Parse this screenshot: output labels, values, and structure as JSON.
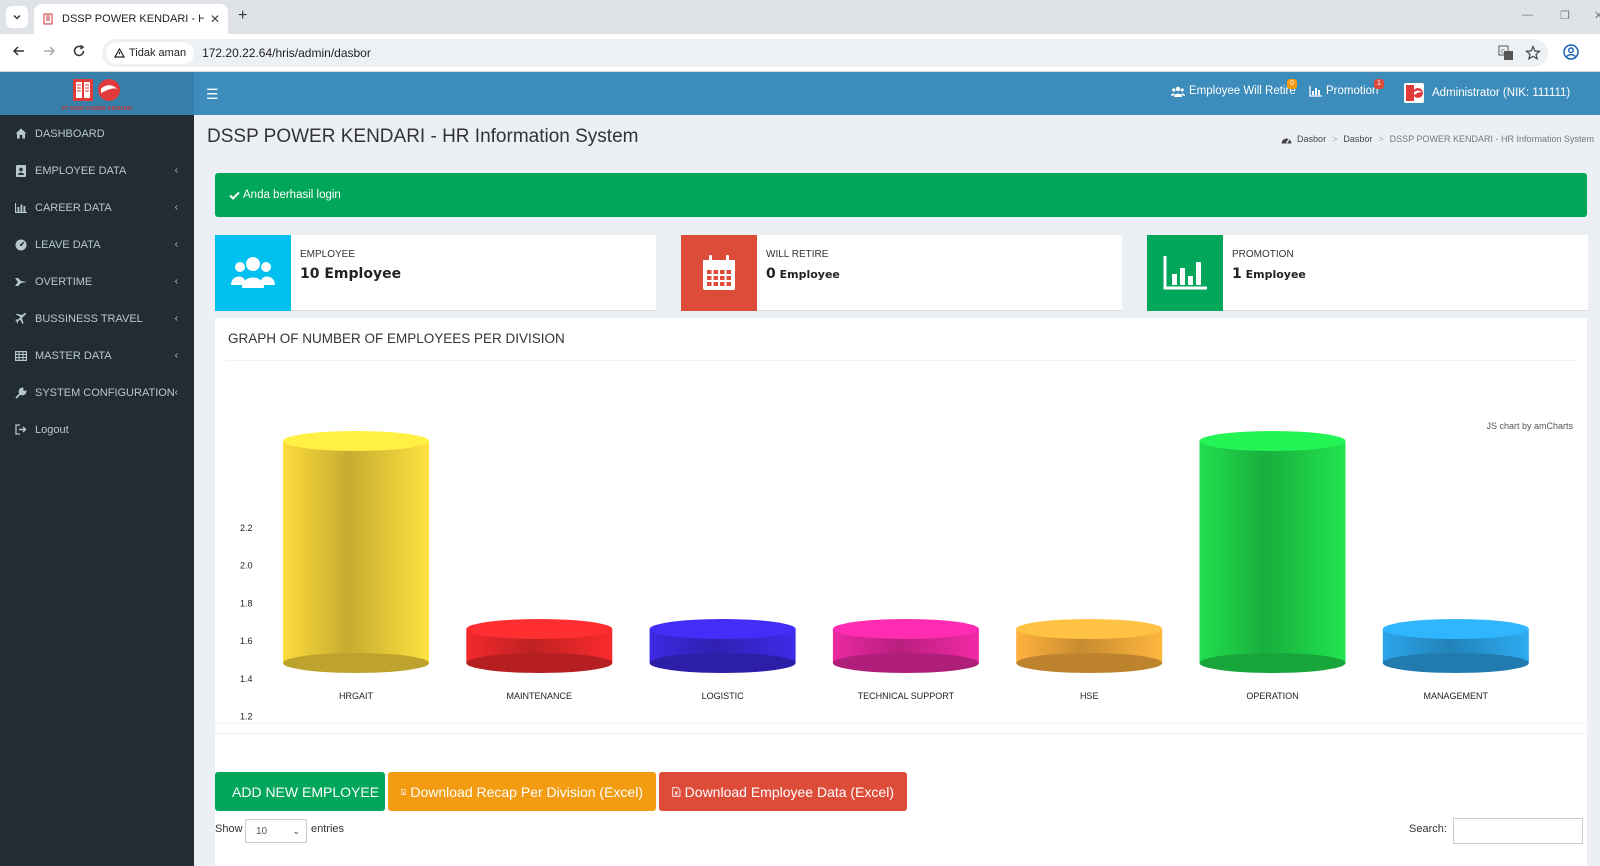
{
  "browser": {
    "tab_title": "DSSP POWER KENDARI - HR Inf",
    "security_label": "Tidak aman",
    "url": "172.20.22.64/hris/admin/dasbor"
  },
  "header": {
    "logo_text": "PT DSSP POWER KENDARI",
    "retire_label": "Employee Will Retire",
    "retire_badge": "0",
    "promotion_label": "Promotion",
    "promotion_badge": "1",
    "user_label": "Administrator (NIK: 111111)"
  },
  "sidebar": {
    "items": [
      {
        "label": "DASHBOARD",
        "icon": "home-icon"
      },
      {
        "label": "EMPLOYEE DATA",
        "icon": "id-card-icon"
      },
      {
        "label": "CAREER DATA",
        "icon": "bar-chart-icon"
      },
      {
        "label": "LEAVE DATA",
        "icon": "dashboard-icon"
      },
      {
        "label": "OVERTIME",
        "icon": "fighter-jet-icon"
      },
      {
        "label": "BUSSINESS TRAVEL",
        "icon": "plane-icon"
      },
      {
        "label": "MASTER DATA",
        "icon": "table-icon"
      },
      {
        "label": "SYSTEM CONFIGURATION",
        "icon": "wrench-icon"
      },
      {
        "label": "Logout",
        "icon": "sign-out-icon"
      }
    ]
  },
  "page": {
    "title": "DSSP POWER KENDARI - HR Information System",
    "breadcrumb": [
      "Dasbor",
      "Dasbor",
      "DSSP POWER KENDARI - HR Information System"
    ],
    "alert": "Anda berhasil login"
  },
  "info_boxes": [
    {
      "label": "EMPLOYEE",
      "count": "10",
      "unit": "Employee",
      "color": "#00c0ef",
      "icon": "users-icon"
    },
    {
      "label": "WILL RETIRE",
      "count": "0",
      "unit": "Employee",
      "color": "#dd4b39",
      "icon": "calendar-icon"
    },
    {
      "label": "PROMOTION",
      "count": "1",
      "unit": "Employee",
      "color": "#00a65a",
      "icon": "bar-chart-icon"
    }
  ],
  "chart": {
    "title": "GRAPH OF NUMBER OF EMPLOYEES PER DIVISION",
    "credit": "JS chart by amCharts"
  },
  "chart_data": {
    "type": "bar",
    "categories": [
      "HRGAIT",
      "MAINTENANCE",
      "LOGISTIC",
      "TECHNICAL SUPPORT",
      "HSE",
      "OPERATION",
      "MANAGEMENT"
    ],
    "values": [
      2,
      1,
      1,
      1,
      1,
      2,
      1
    ],
    "colors": [
      "#f2d13a",
      "#e8282a",
      "#3a27d8",
      "#e0269a",
      "#f3a93a",
      "#1fd44a",
      "#2a9ee0"
    ],
    "ylim": [
      0.8,
      2.2
    ],
    "yticks": [
      "0.8",
      "1.0",
      "1.2",
      "1.4",
      "1.6",
      "1.8",
      "2.0",
      "2.2"
    ],
    "grid": false
  },
  "actions": {
    "add_label": "ADD NEW EMPLOYEE",
    "recap_label": "Download Recap Per Division (Excel)",
    "download_label": "Download Employee Data (Excel)",
    "show_label": "Show",
    "length_value": "10",
    "entries_label": "entries",
    "search_label": "Search:"
  }
}
